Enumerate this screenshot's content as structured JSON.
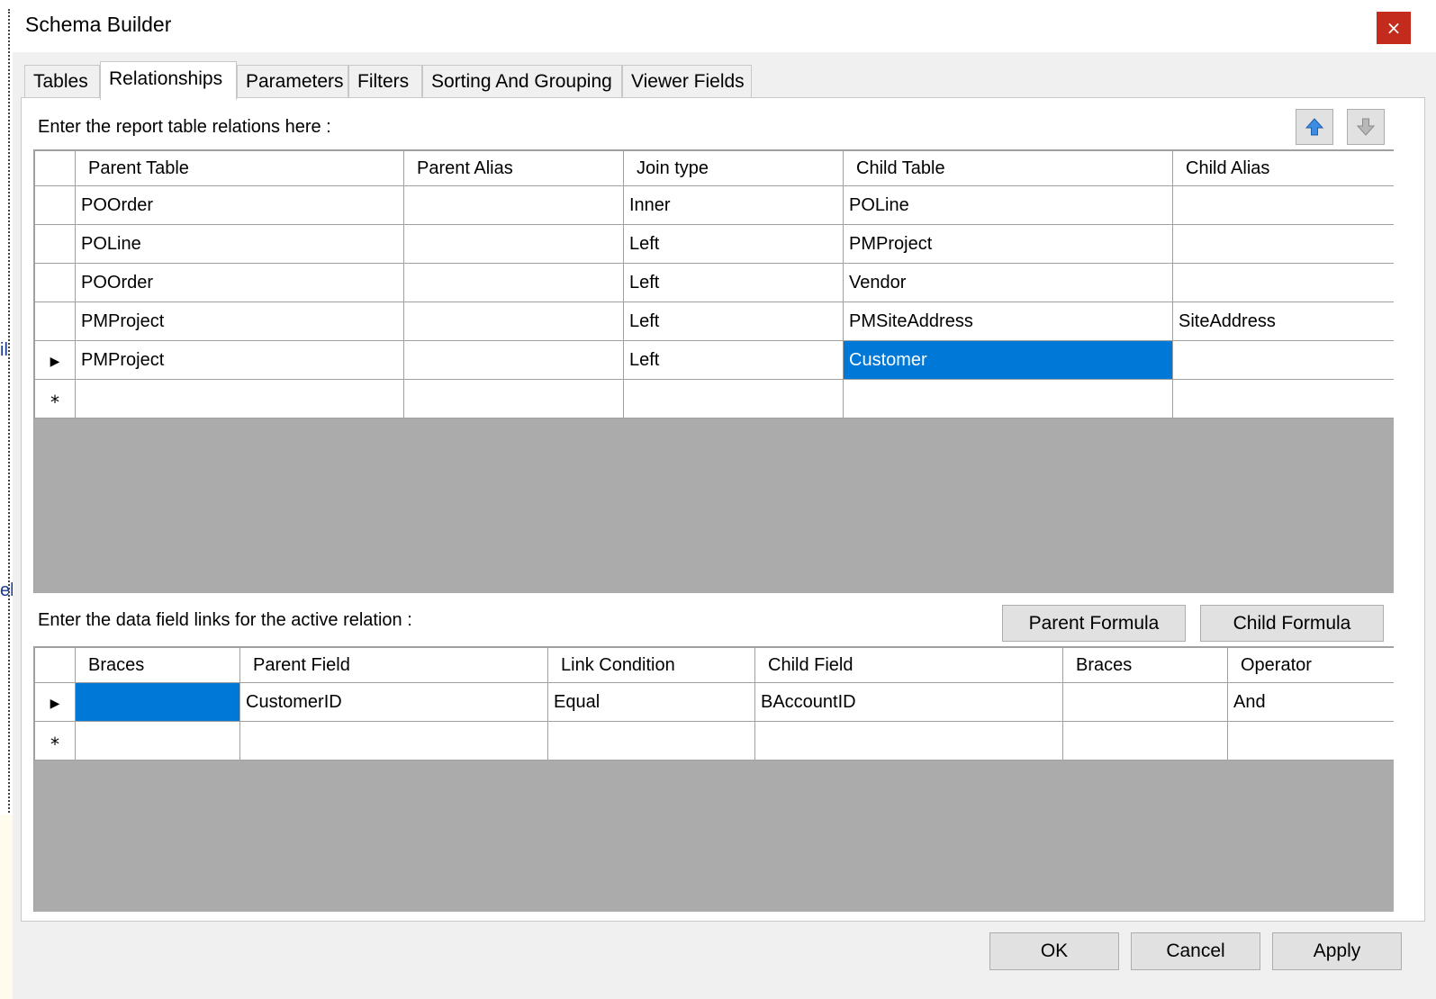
{
  "window": {
    "title": "Schema Builder",
    "close_glyph": "×"
  },
  "background": {
    "peek_text_1": "il",
    "peek_text_2": "el"
  },
  "tabs": [
    "Tables",
    "Relationships",
    "Parameters",
    "Filters",
    "Sorting And Grouping",
    "Viewer Fields"
  ],
  "active_tab": "Relationships",
  "relations": {
    "instruction": "Enter the report table relations here :",
    "move_up_icon": "arrow-up-icon",
    "move_down_icon": "arrow-down-icon",
    "columns": [
      "Parent Table",
      "Parent Alias",
      "Join type",
      "Child Table",
      "Child Alias"
    ],
    "rows": [
      [
        "POOrder",
        "",
        "Inner",
        "POLine",
        ""
      ],
      [
        "POLine",
        "",
        "Left",
        "PMProject",
        ""
      ],
      [
        "POOrder",
        "",
        "Left",
        "Vendor",
        ""
      ],
      [
        "PMProject",
        "",
        "Left",
        "PMSiteAddress",
        "SiteAddress"
      ],
      [
        "PMProject",
        "",
        "Left",
        "Customer",
        ""
      ],
      [
        "",
        "",
        "",
        "",
        ""
      ]
    ],
    "current_row_marker": "▶",
    "new_row_marker": "*",
    "selected_color": "#0078d7"
  },
  "links": {
    "instruction": "Enter the data field links for the active relation :",
    "parent_formula_label": "Parent Formula",
    "child_formula_label": "Child Formula",
    "columns": [
      "Braces",
      "Parent Field",
      "Link Condition",
      "Child Field",
      "Braces",
      "Operator"
    ],
    "rows": [
      [
        "",
        "CustomerID",
        "Equal",
        "BAccountID",
        "",
        "And"
      ],
      [
        "",
        "",
        "",
        "",
        "",
        ""
      ]
    ],
    "current_row_marker": "▶",
    "new_row_marker": "*"
  },
  "footer": {
    "ok_label": "OK",
    "cancel_label": "Cancel",
    "apply_label": "Apply"
  },
  "colors": {
    "close_button": "#c42b1c",
    "grid_empty_area": "#ababab",
    "selection": "#0078d7"
  }
}
